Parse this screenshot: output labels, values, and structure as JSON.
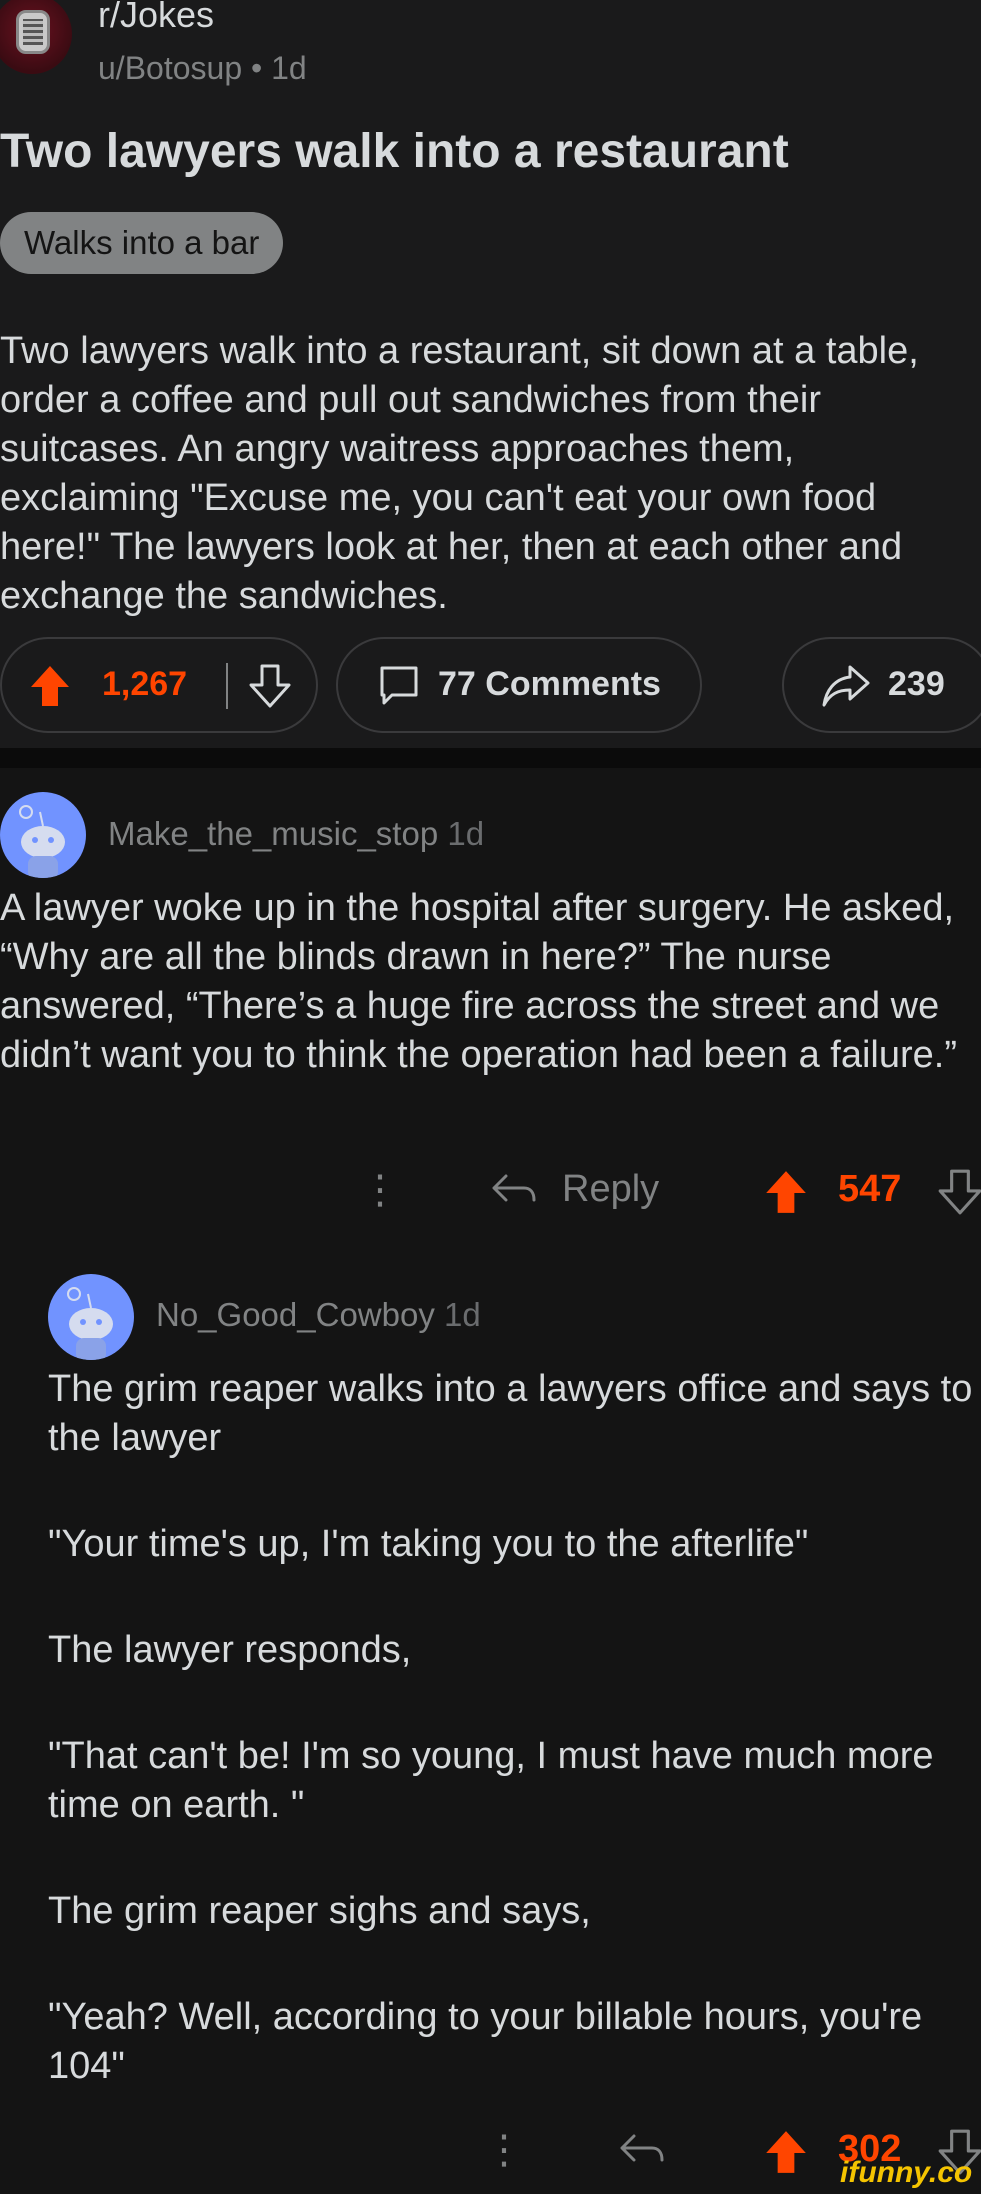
{
  "post": {
    "subreddit": "r/Jokes",
    "author": "u/Botosup",
    "age": "1d",
    "title": "Two lawyers walk into a restaurant",
    "flair": "Walks into a bar",
    "body": "Two lawyers walk into a restaurant, sit down at a table, order a coffee and pull out sandwiches from their suitcases. An angry waitress approaches them, exclaiming \"Excuse me, you can't eat your own food here!\" The lawyers look at her, then at each other and exchange the sandwiches.",
    "score": "1,267",
    "comments_label": "77 Comments",
    "share_count": "239"
  },
  "comments": [
    {
      "username": "Make_the_music_stop",
      "age": "1d",
      "body": "A lawyer woke up in the hospital after surgery. He asked, “Why are all the blinds drawn in here?” The nurse answered, “There’s a huge fire across the street and we didn’t want you to think the operation had been a failure.”",
      "reply_label": "Reply",
      "score": "547"
    },
    {
      "username": "No_Good_Cowboy",
      "age": "1d",
      "paragraphs": [
        "The grim reaper walks into a lawyers office and says to the lawyer",
        "\"Your time's up, I'm taking you to the afterlife\"",
        "The lawyer responds,",
        "\"That can't be!  I'm so young, I must have much more time on earth. \"",
        "The grim reaper sighs and says,",
        "\"Yeah? Well, according to your billable hours, you're 104\""
      ],
      "score": "302"
    }
  ],
  "watermark": "ifunny.co",
  "colors": {
    "background": "#141414",
    "text": "#d7dadc",
    "muted": "#818384",
    "upvote": "#ff4500",
    "avatar": "#7193ff"
  }
}
